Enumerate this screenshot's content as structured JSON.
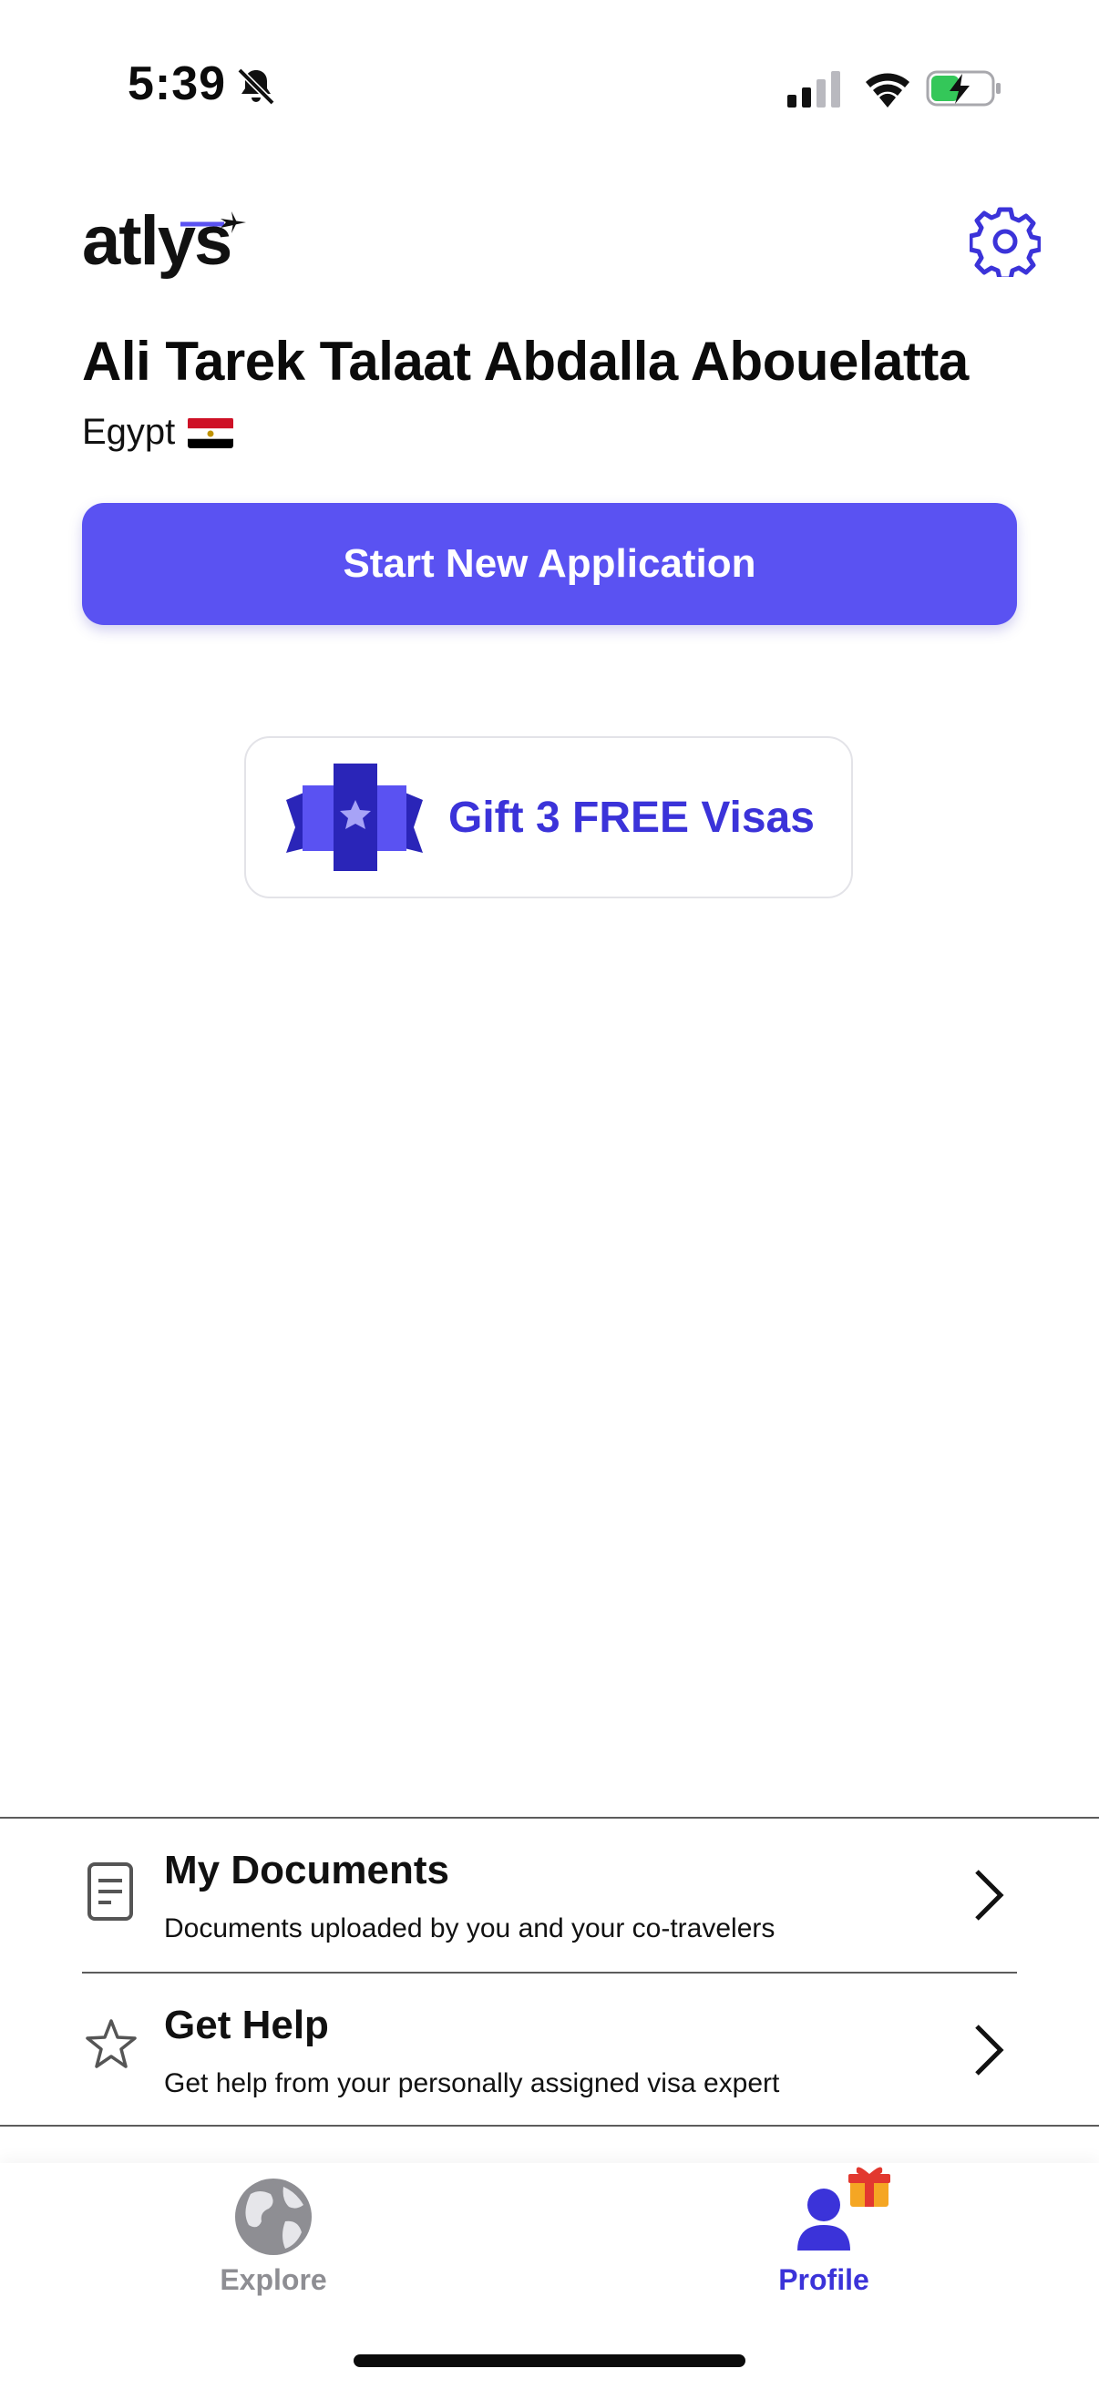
{
  "status_bar": {
    "time": "5:39",
    "icons": [
      "bell-slash-icon",
      "signal-icon",
      "wifi-icon",
      "battery-charging-icon"
    ],
    "battery_color": "#34c759"
  },
  "header": {
    "logo": "atlys",
    "settings_icon": "gear-icon"
  },
  "profile": {
    "name": "Ali Tarek Talaat Abdalla Abouelatta",
    "country": "Egypt",
    "flag_icon": "egypt-flag-icon"
  },
  "actions": {
    "start_new_application": "Start New Application",
    "gift_label": "Gift 3 FREE Visas",
    "gift_icon": "ticket-ribbon-icon"
  },
  "list": [
    {
      "title": "My Documents",
      "subtitle": "Documents uploaded by you and your co-travelers",
      "icon": "document-icon"
    },
    {
      "title": "Get Help",
      "subtitle": "Get help from your personally assigned visa expert",
      "icon": "star-icon"
    }
  ],
  "tabs": [
    {
      "label": "Explore",
      "icon": "globe-icon",
      "active": false
    },
    {
      "label": "Profile",
      "icon": "person-icon",
      "active": true,
      "badge_icon": "gift-icon"
    }
  ],
  "colors": {
    "accent": "#5a52f2",
    "accent_text": "#3b33d9",
    "inactive_tab": "#8e8e93"
  }
}
